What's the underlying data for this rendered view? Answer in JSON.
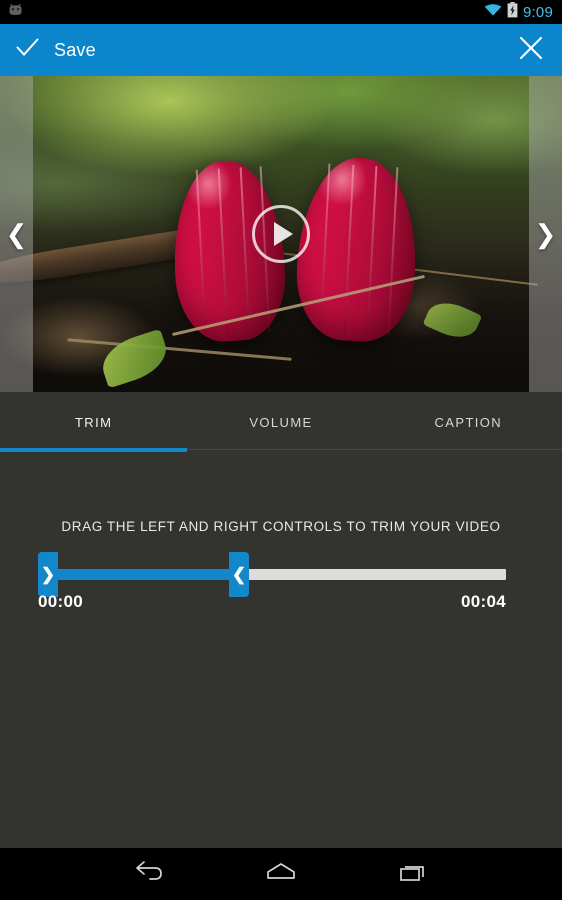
{
  "statusbar": {
    "clock": "9:09",
    "icons": [
      "android-robot-icon",
      "wifi-icon",
      "battery-charging-icon"
    ],
    "clock_color": "#3ec3ef"
  },
  "appbar": {
    "save_label": "Save",
    "check_icon": "check-icon",
    "close_icon": "close-icon",
    "background_color": "#0b86cd"
  },
  "preview": {
    "prev_arrow": "❮",
    "next_arrow": "❯",
    "play_icon": "play-icon",
    "media_description": "macro photo of two red flower buds on forest floor with twigs and green leaves"
  },
  "tabs": [
    {
      "label": "TRIM",
      "active": true
    },
    {
      "label": "VOLUME",
      "active": false
    },
    {
      "label": "CAPTION",
      "active": false
    }
  ],
  "trim": {
    "hint": "DRAG THE LEFT AND RIGHT CONTROLS TO TRIM YOUR VIDEO",
    "start_time": "00:00",
    "end_time": "00:04",
    "left_handle_glyph": "❯",
    "right_handle_glyph": "❮",
    "selected_color": "#1288cb",
    "track_color": "#dcdcdc"
  },
  "navbar": {
    "back_icon": "back-icon",
    "home_icon": "home-icon",
    "recents_icon": "recents-icon"
  },
  "theme": {
    "accent": "#0b86cd",
    "panel_bg": "#333330",
    "system_bg": "#000000"
  }
}
